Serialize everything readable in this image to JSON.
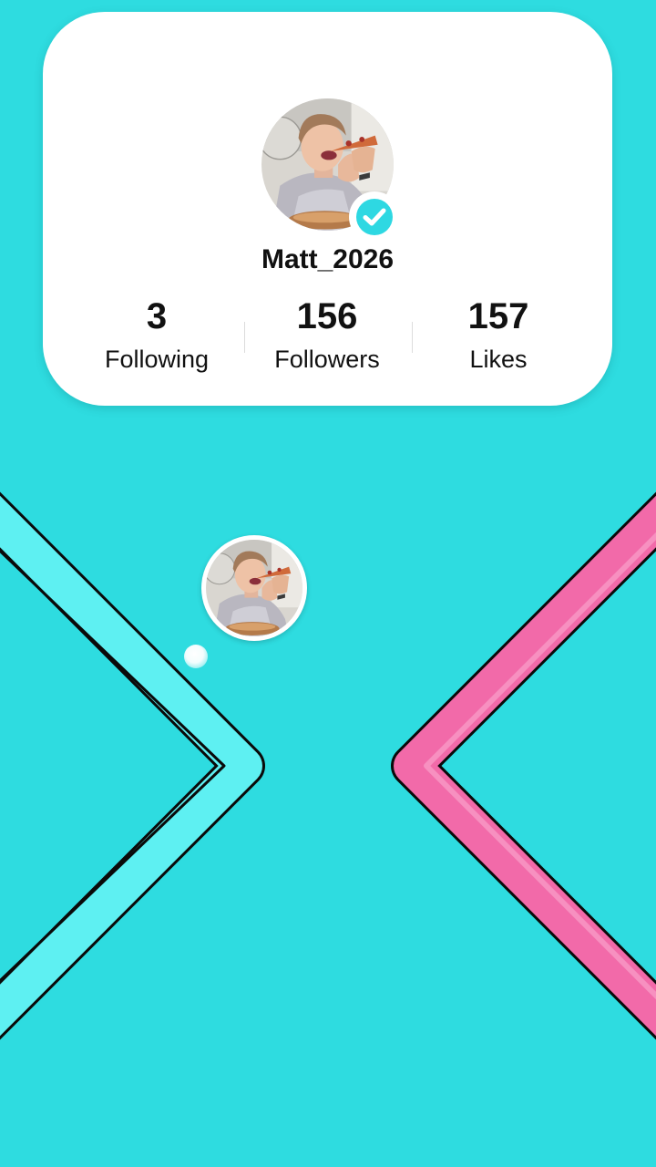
{
  "profile": {
    "username": "Matt_2026",
    "verified": true,
    "avatar_icon": "person-eating-pizza-photo",
    "badge_icon": "verified-check-icon",
    "stats": {
      "following": {
        "value": "3",
        "label": "Following"
      },
      "followers": {
        "value": "156",
        "label": "Followers"
      },
      "likes": {
        "value": "157",
        "label": "Likes"
      }
    }
  },
  "game": {
    "player_avatar_icon": "person-eating-pizza-photo",
    "left_wall_color": "#5ef0f2",
    "right_wall_color": "#f26aa9",
    "background_color": "#2edce0"
  }
}
